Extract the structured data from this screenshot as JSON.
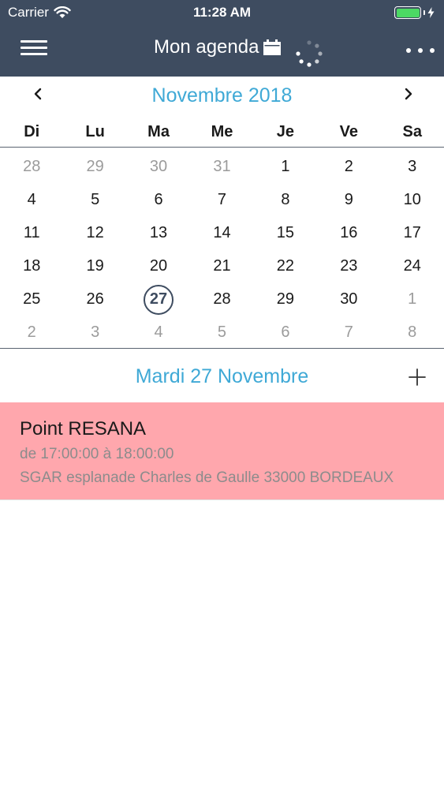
{
  "status_bar": {
    "carrier": "Carrier",
    "time": "11:28 AM",
    "battery_color": "#4cd964"
  },
  "nav": {
    "title": "Mon agenda",
    "menu_icon": "hamburger-icon",
    "title_icon": "calendar-icon",
    "loading_icon": "spinner-icon",
    "more_icon": "more-dots-icon",
    "background": "#3e4c60"
  },
  "calendar": {
    "month_label": "Novembre 2018",
    "prev_icon": "chevron-left-icon",
    "next_icon": "chevron-right-icon",
    "weekdays": [
      "Di",
      "Lu",
      "Ma",
      "Me",
      "Je",
      "Ve",
      "Sa"
    ],
    "weeks": [
      [
        {
          "d": "28",
          "m": true
        },
        {
          "d": "29",
          "m": true
        },
        {
          "d": "30",
          "m": true
        },
        {
          "d": "31",
          "m": true
        },
        {
          "d": "1"
        },
        {
          "d": "2"
        },
        {
          "d": "3"
        }
      ],
      [
        {
          "d": "4"
        },
        {
          "d": "5"
        },
        {
          "d": "6"
        },
        {
          "d": "7"
        },
        {
          "d": "8"
        },
        {
          "d": "9"
        },
        {
          "d": "10"
        }
      ],
      [
        {
          "d": "11"
        },
        {
          "d": "12"
        },
        {
          "d": "13"
        },
        {
          "d": "14"
        },
        {
          "d": "15"
        },
        {
          "d": "16"
        },
        {
          "d": "17"
        }
      ],
      [
        {
          "d": "18"
        },
        {
          "d": "19"
        },
        {
          "d": "20"
        },
        {
          "d": "21"
        },
        {
          "d": "22"
        },
        {
          "d": "23"
        },
        {
          "d": "24"
        }
      ],
      [
        {
          "d": "25"
        },
        {
          "d": "26"
        },
        {
          "d": "27",
          "s": true
        },
        {
          "d": "28"
        },
        {
          "d": "29"
        },
        {
          "d": "30"
        },
        {
          "d": "1",
          "m": true
        }
      ],
      [
        {
          "d": "2",
          "m": true
        },
        {
          "d": "3",
          "m": true
        },
        {
          "d": "4",
          "m": true
        },
        {
          "d": "5",
          "m": true
        },
        {
          "d": "6",
          "m": true
        },
        {
          "d": "7",
          "m": true
        },
        {
          "d": "8",
          "m": true
        }
      ]
    ],
    "accent_color": "#3fa9d6"
  },
  "day": {
    "title": "Mardi 27 Novembre",
    "add_icon": "plus-icon"
  },
  "events": [
    {
      "title": "Point RESANA",
      "time": "de 17:00:00 à 18:00:00",
      "place": "SGAR esplanade Charles de Gaulle 33000 BORDEAUX",
      "color": "#ffa7ad"
    }
  ]
}
